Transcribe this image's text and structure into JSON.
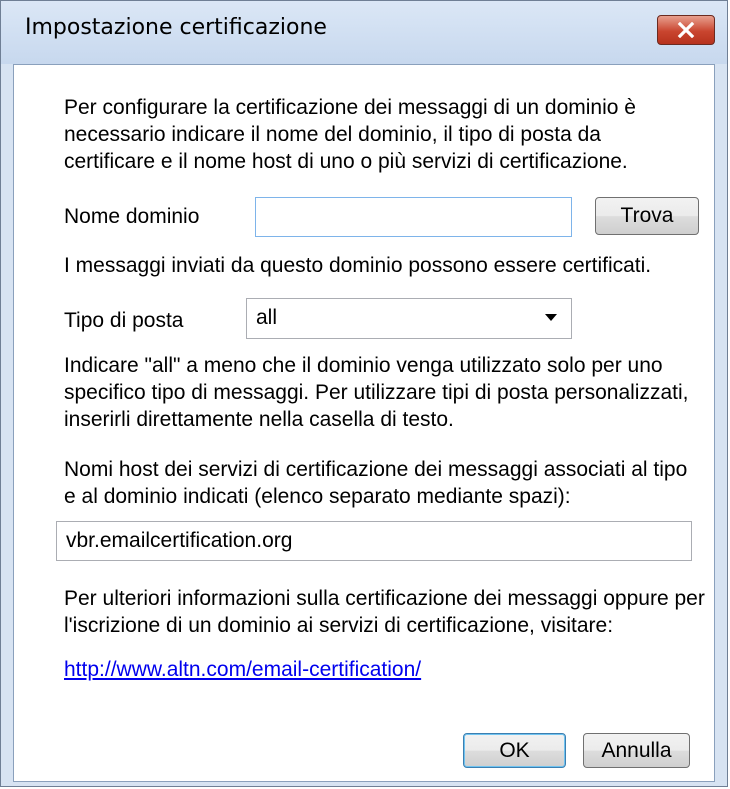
{
  "window": {
    "title": "Impostazione certificazione",
    "close_icon": "close-icon"
  },
  "intro": {
    "line1": "Per configurare la certificazione dei messaggi di un dominio è",
    "line2": "necessario indicare il nome del dominio, il tipo di posta da",
    "line3": "certificare e il nome host di uno o più servizi di certificazione."
  },
  "domain": {
    "label": "Nome dominio",
    "value": "",
    "find_button": "Trova",
    "hint": "I messaggi inviati da questo dominio possono essere certificati."
  },
  "mail_type": {
    "label": "Tipo di posta",
    "selected": "all",
    "hint_line1": "Indicare \"all\" a meno che il dominio venga utilizzato solo per uno",
    "hint_line2": "specifico tipo di messaggi. Per utilizzare tipi di posta personalizzati,",
    "hint_line3": "inserirli direttamente nella casella di testo."
  },
  "hosts": {
    "label_line1": "Nomi host dei servizi di certificazione dei messaggi associati al tipo",
    "label_line2": "e al dominio indicati (elenco separato mediante spazi):",
    "value": "vbr.emailcertification.org"
  },
  "more_info": {
    "line1": "Per ulteriori informazioni sulla certificazione dei messaggi oppure per",
    "line2": "l'iscrizione di un dominio ai servizi di certificazione, visitare:",
    "link": "http://www.altn.com/email-certification/"
  },
  "buttons": {
    "ok": "OK",
    "cancel": "Annulla"
  }
}
